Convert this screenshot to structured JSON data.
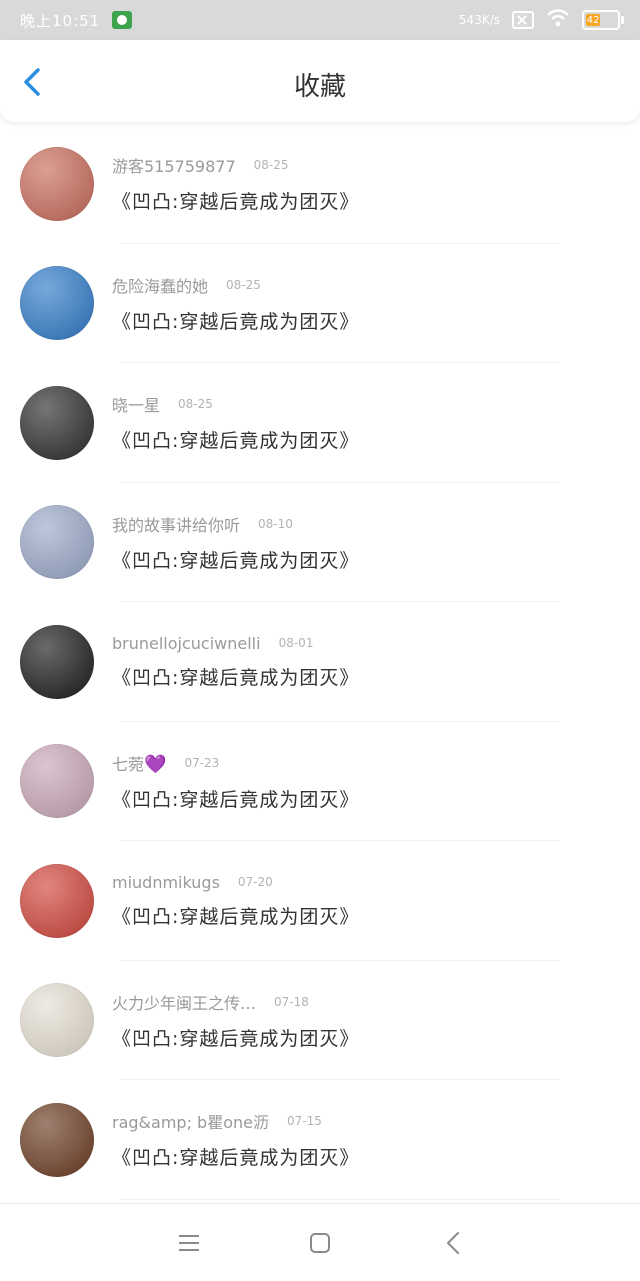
{
  "status": {
    "time": "晚上10:51",
    "speed": "543K/s",
    "battery": "42"
  },
  "header": {
    "title": "收藏",
    "back_icon": "chevron-left-icon"
  },
  "colors": {
    "accent": "#2a8de0",
    "battery": "#f5a623",
    "heart": "#7a23c9"
  },
  "items": [
    {
      "user": "游客515759877",
      "date": "08-25",
      "book": "《凹凸:穿越后竟成为团灭》",
      "avatar_color": "#c86b5a"
    },
    {
      "user": "危险海蠢的她",
      "date": "08-25",
      "book": "《凹凸:穿越后竟成为团灭》",
      "avatar_color": "#2f7ac8"
    },
    {
      "user": "晓一星",
      "date": "08-25",
      "book": "《凹凸:穿越后竟成为团灭》",
      "avatar_color": "#2b2b2b"
    },
    {
      "user": "我的故事讲给你听",
      "date": "08-10",
      "book": "《凹凸:穿越后竟成为团灭》",
      "avatar_color": "#9aa8c8"
    },
    {
      "user": "brunellojcuciwnelli",
      "date": "08-01",
      "book": "《凹凸:穿越后竟成为团灭》",
      "avatar_color": "#1a1a1a"
    },
    {
      "user": "七菀",
      "date": "07-23",
      "book": "《凹凸:穿越后竟成为团灭》",
      "avatar_color": "#c9a6b8",
      "emoji": "💜"
    },
    {
      "user": "miudnmikugs",
      "date": "07-20",
      "book": "《凹凸:穿越后竟成为团灭》",
      "avatar_color": "#d0443a"
    },
    {
      "user": "火力少年闽王之传…",
      "date": "07-18",
      "book": "《凹凸:穿越后竟成为团灭》",
      "avatar_color": "#e6dfd2"
    },
    {
      "user": "rag&amp; b瞿one沥",
      "date": "07-15",
      "book": "《凹凸:穿越后竟成为团灭》",
      "avatar_color": "#6b3b22"
    }
  ],
  "nav": {
    "menu_icon": "menu-icon",
    "home_icon": "square-home-icon",
    "back_icon": "triangle-back-icon"
  }
}
